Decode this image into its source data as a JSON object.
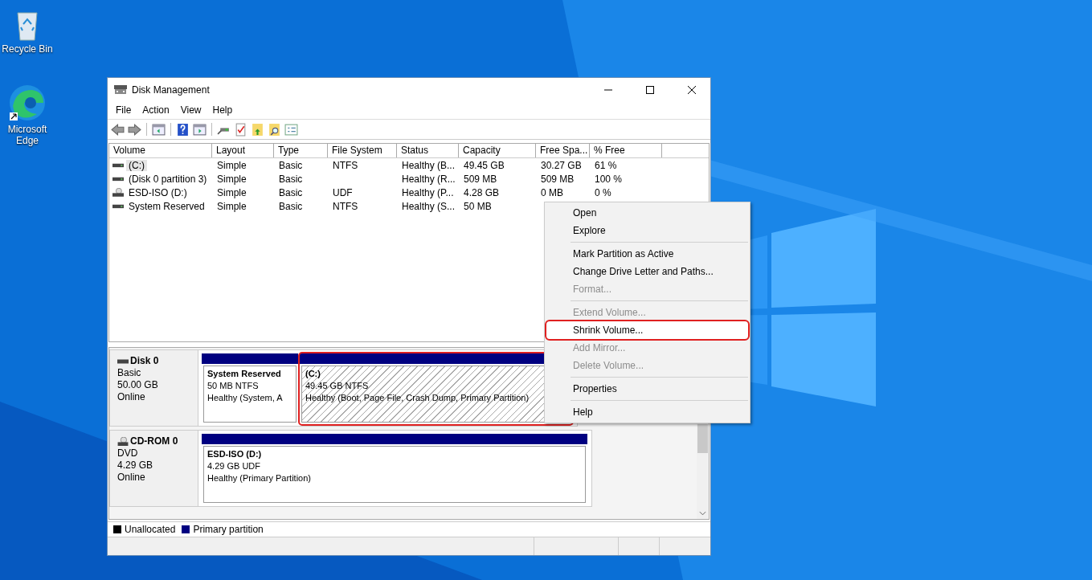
{
  "desktop_icons": [
    {
      "label": "Recycle Bin",
      "kind": "bin"
    },
    {
      "label": "Microsoft Edge",
      "kind": "edge"
    }
  ],
  "window": {
    "title": "Disk Management"
  },
  "menu_bar": [
    "File",
    "Action",
    "View",
    "Help"
  ],
  "volume_table": {
    "columns": [
      "Volume",
      "Layout",
      "Type",
      "File System",
      "Status",
      "Capacity",
      "Free Spa...",
      "% Free"
    ],
    "rows": [
      {
        "kind": "disk",
        "selected": true,
        "cells": [
          "(C:)",
          "Simple",
          "Basic",
          "NTFS",
          "Healthy (B...",
          "49.45 GB",
          "30.27 GB",
          "61 %"
        ]
      },
      {
        "kind": "disk",
        "selected": false,
        "cells": [
          "(Disk 0 partition 3)",
          "Simple",
          "Basic",
          "",
          "Healthy (R...",
          "509 MB",
          "509 MB",
          "100 %"
        ]
      },
      {
        "kind": "optical",
        "selected": false,
        "cells": [
          "ESD-ISO (D:)",
          "Simple",
          "Basic",
          "UDF",
          "Healthy (P...",
          "4.28 GB",
          "0 MB",
          "0 %"
        ]
      },
      {
        "kind": "disk",
        "selected": false,
        "cells": [
          "System Reserved",
          "Simple",
          "Basic",
          "NTFS",
          "Healthy (S...",
          "50 MB",
          "",
          ""
        ]
      }
    ]
  },
  "disks": [
    {
      "kind": "disk",
      "name": "Disk 0",
      "type": "Basic",
      "size": "50.00 GB",
      "state": "Online",
      "partitions": [
        {
          "name": "System Reserved",
          "size": "50 MB NTFS",
          "status": "Healthy (System, A",
          "selected": false,
          "highlighted": false
        },
        {
          "name": "(C:)",
          "size": "49.45 GB NTFS",
          "status": "Healthy (Boot, Page File, Crash Dump, Primary Partition)",
          "selected": true,
          "highlighted": true
        }
      ]
    },
    {
      "kind": "optical",
      "name": "CD-ROM 0",
      "type": "DVD",
      "size": "4.29 GB",
      "state": "Online",
      "partitions": [
        {
          "name": "ESD-ISO  (D:)",
          "size": "4.29 GB UDF",
          "status": "Healthy (Primary Partition)",
          "selected": false,
          "highlighted": false
        }
      ]
    }
  ],
  "legend": [
    {
      "label": "Unallocated",
      "color": "#000000"
    },
    {
      "label": "Primary partition",
      "color": "#000080"
    }
  ],
  "context_menu": {
    "groups": [
      [
        {
          "label": "Open",
          "disabled": false,
          "highlighted": false
        },
        {
          "label": "Explore",
          "disabled": false,
          "highlighted": false
        }
      ],
      [
        {
          "label": "Mark Partition as Active",
          "disabled": false,
          "highlighted": false
        },
        {
          "label": "Change Drive Letter and Paths...",
          "disabled": false,
          "highlighted": false
        },
        {
          "label": "Format...",
          "disabled": true,
          "highlighted": false
        }
      ],
      [
        {
          "label": "Extend Volume...",
          "disabled": true,
          "highlighted": false
        },
        {
          "label": "Shrink Volume...",
          "disabled": false,
          "highlighted": true
        },
        {
          "label": "Add Mirror...",
          "disabled": true,
          "highlighted": false
        },
        {
          "label": "Delete Volume...",
          "disabled": true,
          "highlighted": false
        }
      ],
      [
        {
          "label": "Properties",
          "disabled": false,
          "highlighted": false
        }
      ],
      [
        {
          "label": "Help",
          "disabled": false,
          "highlighted": false
        }
      ]
    ]
  }
}
